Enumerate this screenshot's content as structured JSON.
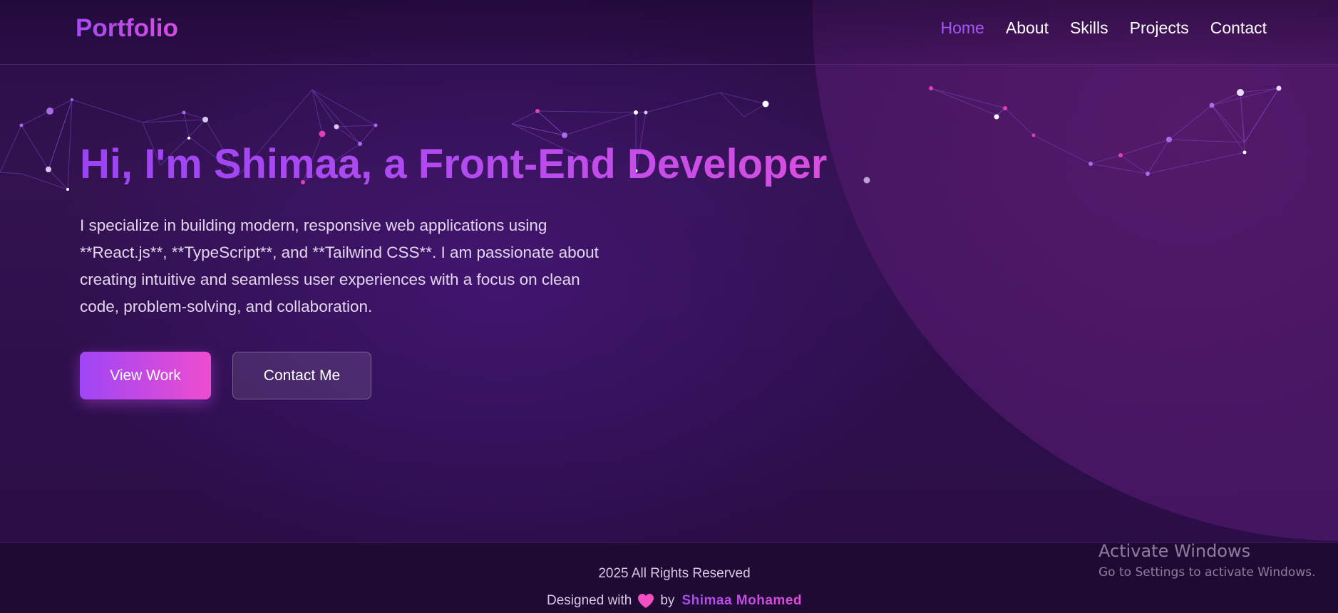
{
  "header": {
    "logo": "Portfolio",
    "nav": [
      {
        "label": "Home",
        "active": true
      },
      {
        "label": "About",
        "active": false
      },
      {
        "label": "Skills",
        "active": false
      },
      {
        "label": "Projects",
        "active": false
      },
      {
        "label": "Contact",
        "active": false
      }
    ]
  },
  "hero": {
    "title": "Hi, I'm Shimaa, a Front-End Developer",
    "description": "I specialize in building modern, responsive web applications using **React.js**, **TypeScript**, and **Tailwind CSS**. I am passionate about creating intuitive and seamless user experiences with a focus on clean code, problem-solving, and collaboration.",
    "primary_button": "View Work",
    "secondary_button": "Contact Me"
  },
  "footer": {
    "copyright": "2025 All Rights Reserved",
    "designed_prefix": "Designed with",
    "designed_by": "by",
    "author": "Shimaa Mohamed",
    "heart_icon": "heart-icon"
  },
  "watermark": {
    "title": "Activate Windows",
    "subtitle": "Go to Settings to activate Windows."
  },
  "colors": {
    "accent": "#a855f7",
    "pink": "#ec4899",
    "background": "#2a0d48"
  }
}
